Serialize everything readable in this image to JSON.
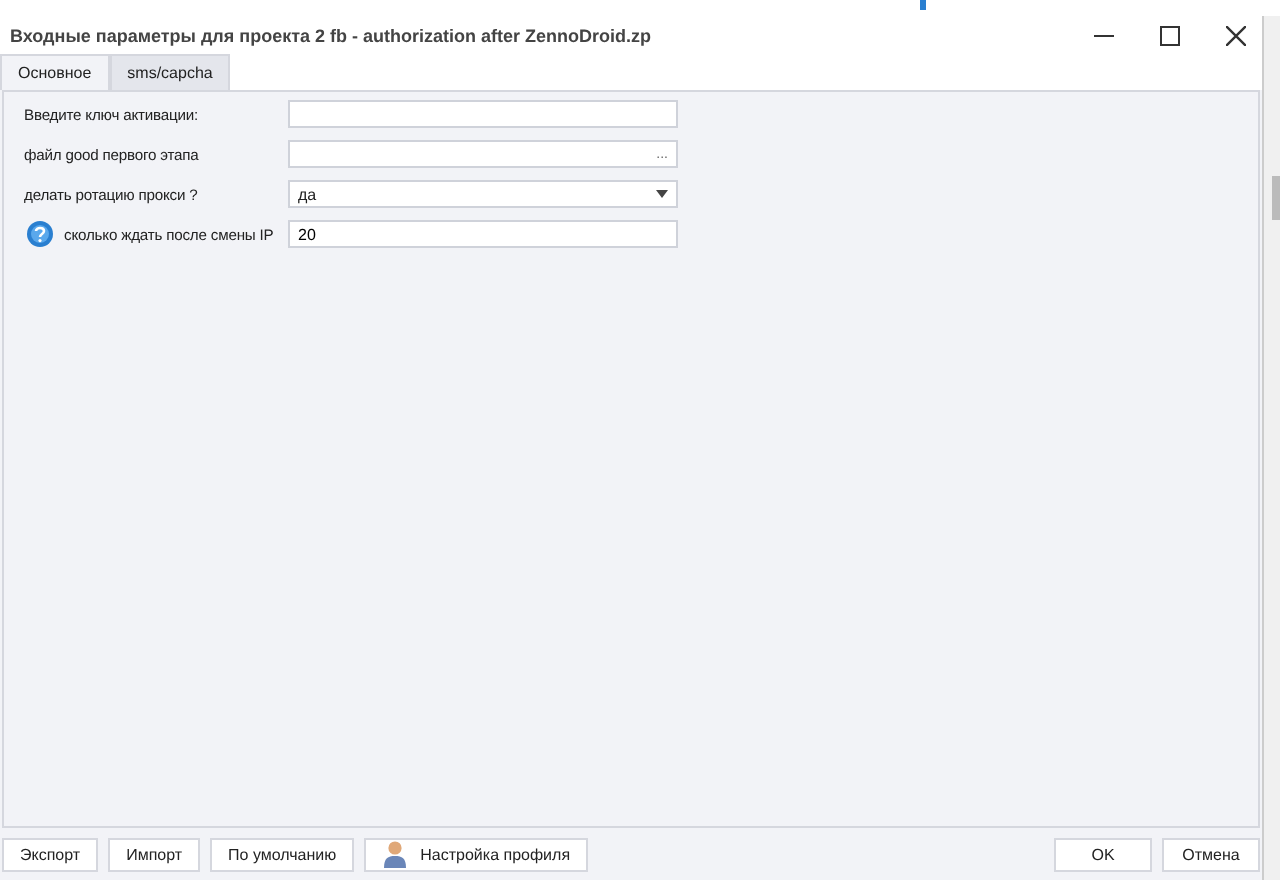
{
  "window": {
    "title": "Входные параметры для проекта 2 fb - authorization after ZennoDroid.zp"
  },
  "tabs": [
    {
      "label": "Основное",
      "selected": true
    },
    {
      "label": "sms/capcha",
      "selected": false
    }
  ],
  "fields": [
    {
      "kind": "text",
      "label": "Введите ключ активации:",
      "help": false
    },
    {
      "kind": "file",
      "label": "файл good первого этапа",
      "browse": "...",
      "help": false
    },
    {
      "kind": "dropdown",
      "label": "делать ротацию прокси ?",
      "value": "да",
      "help": false
    },
    {
      "kind": "text",
      "label": "сколько ждать после смены IP",
      "value": "20",
      "help": true
    }
  ],
  "buttons_left": [
    "Экспорт",
    "Импорт",
    "По умолчанию",
    "Настройка профиля"
  ],
  "buttons_right": [
    "OK",
    "Отмена"
  ]
}
